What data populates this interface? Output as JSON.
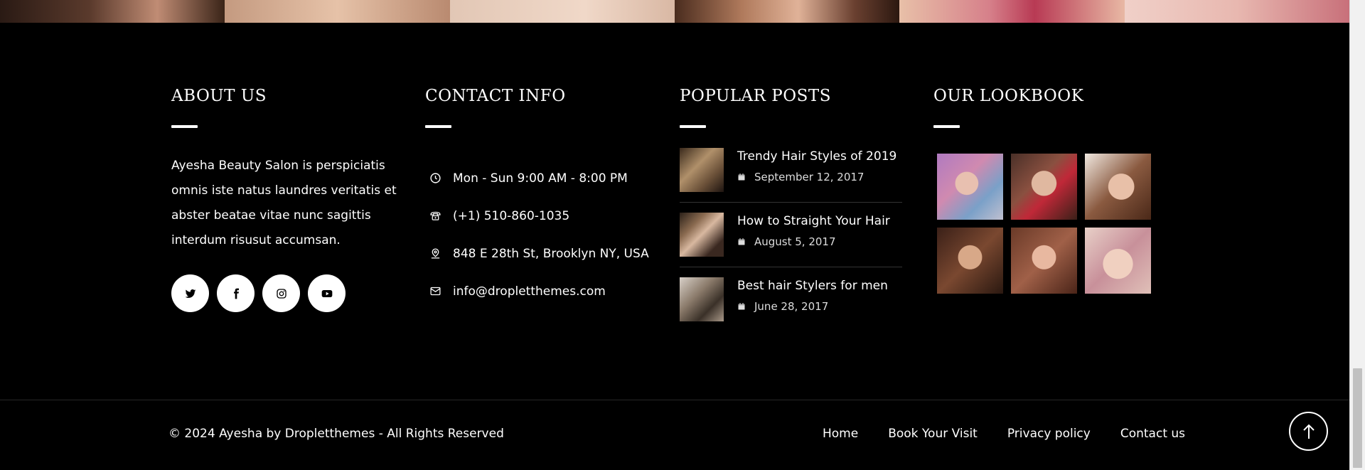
{
  "photo_strip": {
    "count": 6
  },
  "about": {
    "title": "ABOUT US",
    "text": "Ayesha Beauty Salon is perspiciatis omnis iste natus laundres veritatis et abster beatae vitae nunc sagittis interdum risusut accumsan.",
    "socials": [
      {
        "icon": "twitter-icon"
      },
      {
        "icon": "facebook-icon"
      },
      {
        "icon": "instagram-icon"
      },
      {
        "icon": "youtube-icon"
      }
    ]
  },
  "contact": {
    "title": "CONTACT INFO",
    "hours": "Mon - Sun 9:00 AM - 8:00 PM",
    "phone": "(+1) 510-860-1035",
    "address": "848 E 28th St, Brooklyn NY, USA",
    "email": "info@dropletthemes.com"
  },
  "posts": {
    "title": "POPULAR POSTS",
    "items": [
      {
        "title": "Trendy Hair Styles of 2019",
        "date": "September 12, 2017"
      },
      {
        "title": "How to Straight Your Hair",
        "date": "August 5, 2017"
      },
      {
        "title": "Best hair Stylers for men",
        "date": "June 28, 2017"
      }
    ]
  },
  "lookbook": {
    "title": "OUR LOOKBOOK",
    "count": 6
  },
  "bottom": {
    "copyright": "© 2024 Ayesha by Dropletthemes - All Rights Reserved",
    "nav": [
      "Home",
      "Book Your Visit",
      "Privacy policy",
      "Contact us"
    ]
  },
  "colors": {
    "background": "#000000",
    "text": "#ffffff",
    "divider": "#262626"
  }
}
